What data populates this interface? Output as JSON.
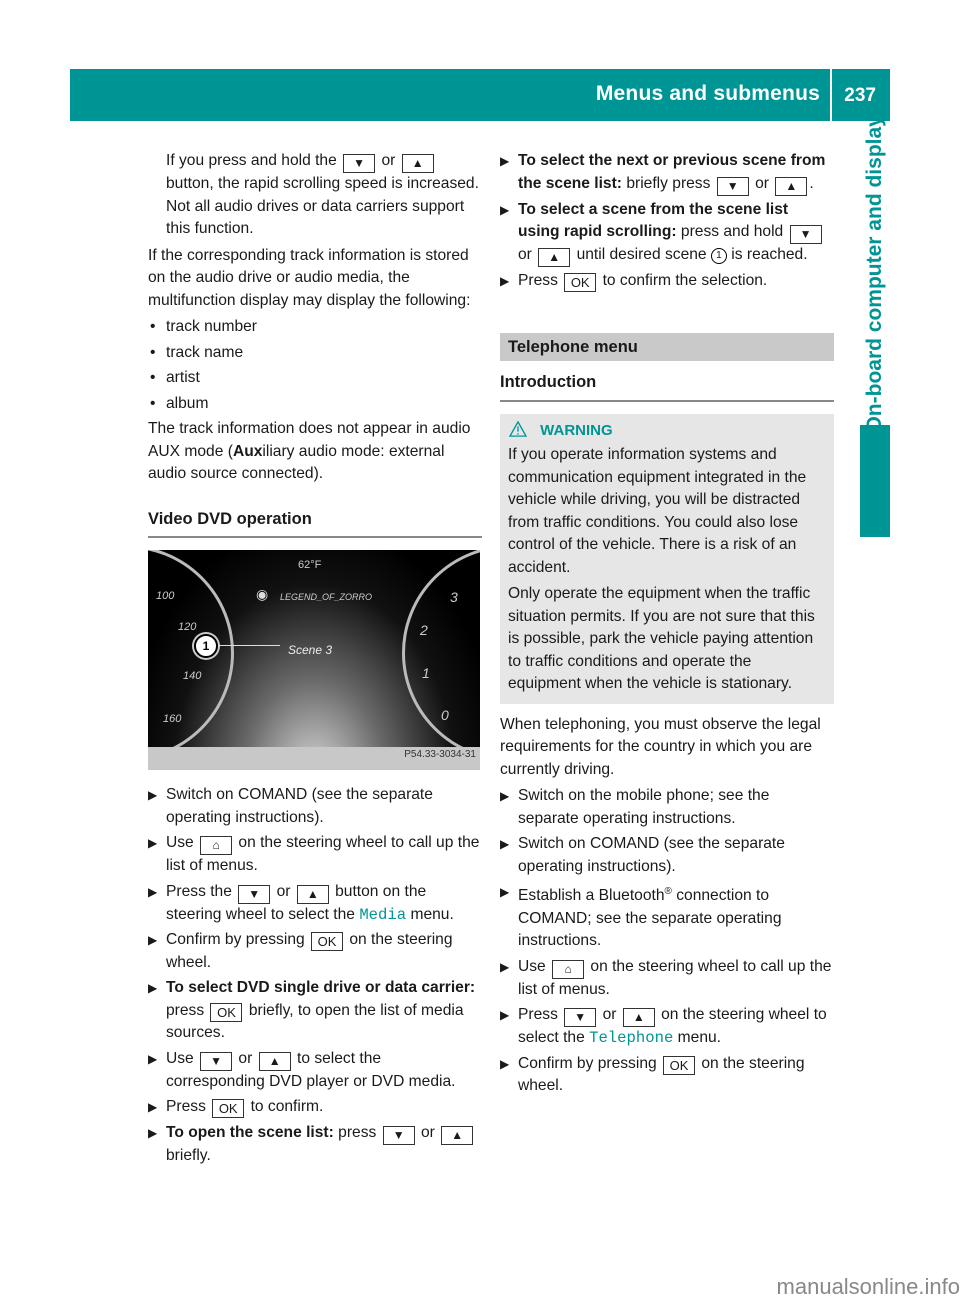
{
  "header": {
    "title": "Menus and submenus",
    "page_number": "237",
    "side_tab": "On-board computer and displays"
  },
  "colors": {
    "accent": "#009595",
    "section_bar": "#c9c9c9",
    "warning_bg": "#e6e6e6"
  },
  "left": {
    "intro_para": [
      "If you press and hold the",
      "or",
      "button, the rapid scrolling speed is increased. Not all audio drives or data carriers support this function."
    ],
    "track_para": "If the corresponding track information is stored on the audio drive or audio media, the multifunction display may display the following:",
    "track_items": [
      "track number",
      "track name",
      "artist",
      "album"
    ],
    "aux_para": {
      "before": "The track information does not appear in audio AUX mode (",
      "bold": "Aux",
      "after": "iliary audio mode: external audio source connected)."
    },
    "section_title": "Video DVD operation",
    "figure": {
      "temperature": "62°F",
      "disc_title": "LEGEND_OF_ZORRO",
      "scene": "Scene 3",
      "callout": "1",
      "speed_labels": [
        "100",
        "120",
        "140",
        "160"
      ],
      "rpm_labels": [
        "3",
        "2",
        "1",
        "0"
      ],
      "code": "P54.33-3034-31"
    },
    "steps": [
      {
        "parts": [
          "Switch on COMAND (see the separate operating instructions)."
        ]
      },
      {
        "parts": [
          "Use",
          "on the steering wheel to call up the list of menus."
        ]
      },
      {
        "parts": [
          "Press the",
          "or",
          "button on the steering wheel to select the",
          "Media",
          "menu."
        ]
      },
      {
        "parts": [
          "Confirm by pressing",
          "on the steering wheel."
        ]
      },
      {
        "bold": "To select DVD single drive or data carrier:",
        "parts": [
          "press",
          "briefly, to open the list of media sources."
        ]
      },
      {
        "parts": [
          "Use",
          "or",
          "to select the corresponding DVD player or DVD media."
        ]
      },
      {
        "parts": [
          "Press",
          "to confirm."
        ]
      },
      {
        "bold": "To open the scene list:",
        "parts": [
          "press",
          "or",
          "briefly."
        ]
      }
    ]
  },
  "right": {
    "steps": [
      {
        "bold": "To select the next or previous scene from the scene list:",
        "parts": [
          "briefly press",
          "or",
          "."
        ]
      },
      {
        "bold": "To select a scene from the scene list using rapid scrolling:",
        "parts": [
          "press and hold",
          "or",
          "until desired scene",
          "is reached."
        ]
      },
      {
        "parts": [
          "Press",
          "to confirm the selection."
        ]
      }
    ],
    "section_bar": "Telephone menu",
    "subsection": "Introduction",
    "warning": {
      "label": "WARNING",
      "para1": "If you operate information systems and communication equipment integrated in the vehicle while driving, you will be distracted from traffic conditions. You could also lose control of the vehicle. There is a risk of an accident.",
      "para2": "Only operate the equipment when the traffic situation permits. If you are not sure that this is possible, park the vehicle paying attention to traffic conditions and operate the equipment when the vehicle is stationary."
    },
    "legal_para": "When telephoning, you must observe the legal requirements for the country in which you are currently driving.",
    "tel_steps": [
      {
        "parts": [
          "Switch on the mobile phone; see the separate operating instructions."
        ]
      },
      {
        "parts": [
          "Switch on COMAND (see the separate operating instructions)."
        ]
      },
      {
        "parts": [
          "Establish a Bluetooth",
          "®",
          "connection to COMAND; see the separate operating instructions."
        ]
      },
      {
        "parts": [
          "Use",
          "on the steering wheel to call up the list of menus."
        ]
      },
      {
        "parts": [
          "Press",
          "or",
          "on the steering wheel to select the",
          "Telephone",
          "menu."
        ]
      },
      {
        "parts": [
          "Confirm by pressing",
          "on the steering wheel."
        ]
      }
    ]
  },
  "keys": {
    "down": "▼",
    "up": "▲",
    "ok": "OK",
    "home": "⌂"
  },
  "watermark": "manualsonline.info"
}
